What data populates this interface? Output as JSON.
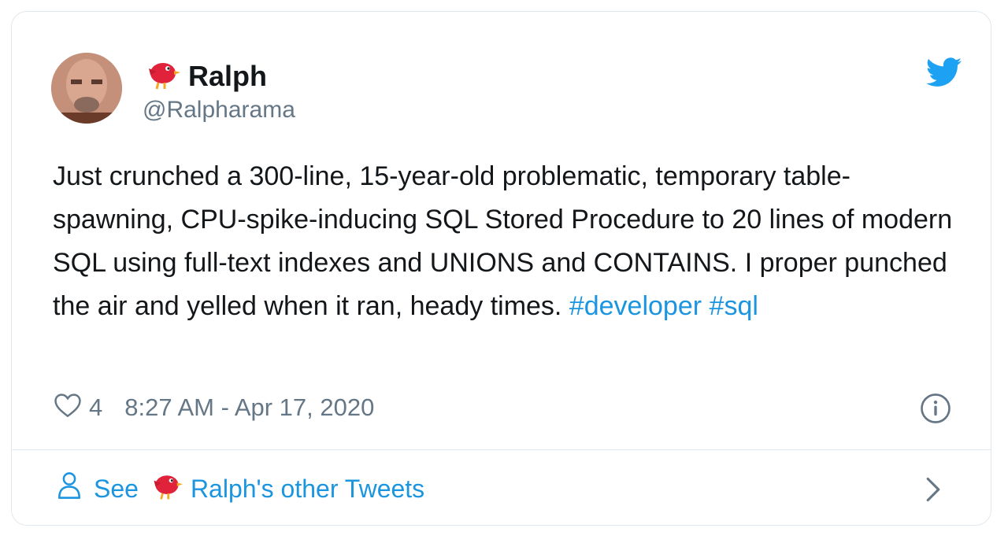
{
  "tweet": {
    "author": {
      "name": "Ralph",
      "handle": "@Ralpharama",
      "name_emoji": "bird-emoji",
      "avatar": "profile-photo"
    },
    "text_plain": "Just crunched a 300-line, 15-year-old problematic, temporary table-spawning, CPU-spike-inducing SQL Stored Procedure to 20 lines of modern SQL using full-text indexes and UNIONS and CONTAINS. I proper punched the air and yelled when it ran, heady times.",
    "hashtags": [
      "#developer",
      "#sql"
    ],
    "likes": "4",
    "timestamp": "8:27 AM - Apr 17, 2020",
    "icons": {
      "like": "heart-icon",
      "info": "info-icon",
      "brand": "twitter-bird-icon",
      "person": "person-icon",
      "chevron": "chevron-right-icon"
    }
  },
  "footer": {
    "see_label": "See",
    "other_tweets_label": "Ralph's other Tweets"
  },
  "colors": {
    "link": "#1b95e0",
    "muted": "#657786",
    "text": "#14171a",
    "border": "#e1e8ed",
    "brand": "#1da1f2"
  }
}
